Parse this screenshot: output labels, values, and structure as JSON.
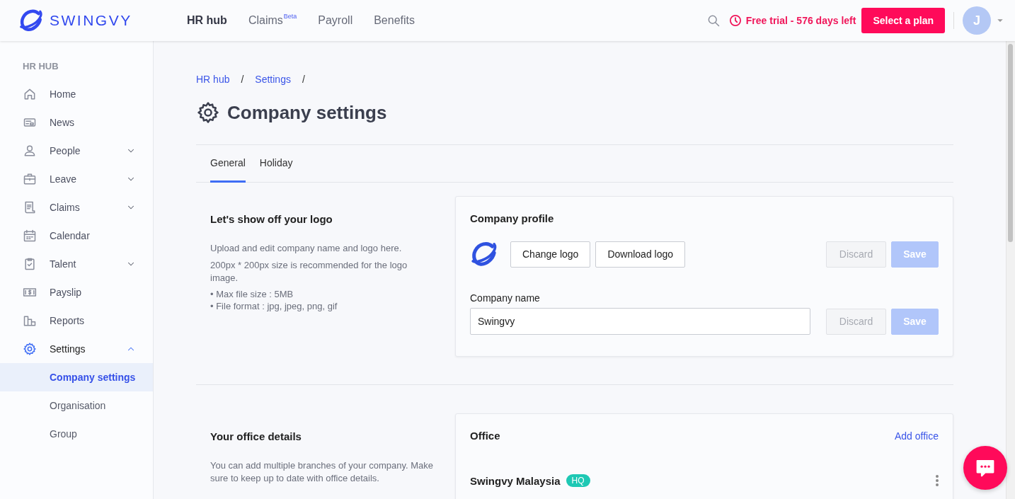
{
  "header": {
    "brand": "SWINGVY",
    "nav": [
      {
        "label": "HR hub",
        "selected": true
      },
      {
        "label": "Claims",
        "selected": false,
        "badge": "Beta"
      },
      {
        "label": "Payroll",
        "selected": false
      },
      {
        "label": "Benefits",
        "selected": false
      }
    ],
    "trial": "Free trial - 576 days left",
    "plan_button": "Select a plan",
    "avatar": "J"
  },
  "sidebar": {
    "heading": "HR HUB",
    "items": [
      {
        "label": "Home",
        "selected": false
      },
      {
        "label": "News",
        "selected": false
      },
      {
        "label": "People",
        "selected": false,
        "expanded": false
      },
      {
        "label": "Leave",
        "selected": false,
        "expanded": false
      },
      {
        "label": "Claims",
        "selected": false,
        "expanded": false
      },
      {
        "label": "Calendar",
        "selected": false
      },
      {
        "label": "Talent",
        "selected": false,
        "expanded": false
      },
      {
        "label": "Payslip",
        "selected": false
      },
      {
        "label": "Reports",
        "selected": false
      },
      {
        "label": "Settings",
        "selected": true,
        "expanded": true,
        "children": [
          {
            "label": "Company settings",
            "selected": true
          },
          {
            "label": "Organisation",
            "selected": false
          },
          {
            "label": "Group",
            "selected": false
          }
        ]
      }
    ]
  },
  "breadcrumb": [
    {
      "label": "HR hub",
      "separator": "/"
    },
    {
      "label": "Settings",
      "separator": "/"
    }
  ],
  "title": "Company settings",
  "tabs": [
    {
      "label": "General",
      "selected": true
    },
    {
      "label": "Holiday",
      "selected": false
    }
  ],
  "logo_section": {
    "heading": "Let's show off your logo",
    "description": [
      "Upload and edit company name and logo here.",
      "200px * 200px size is recommended for the logo image."
    ],
    "bullets": [
      "• Max file size : 5MB",
      "• File format : jpg, jpeg, png, gif"
    ],
    "card": {
      "title": "Company profile",
      "logo_buttons": [
        "Change logo",
        "Download logo"
      ],
      "logo_actions": [
        {
          "label": "Discard",
          "kind": "discard",
          "disabled": true
        },
        {
          "label": "Save",
          "kind": "save",
          "disabled": true
        }
      ],
      "name_label": "Company name",
      "name_value": "Swingvy",
      "name_actions": [
        {
          "label": "Discard",
          "kind": "discard",
          "disabled": true
        },
        {
          "label": "Save",
          "kind": "save",
          "disabled": true
        }
      ]
    }
  },
  "office_section": {
    "heading": "Your office details",
    "description": "You can add multiple branches of your company. Make sure to keep up to date with office details.",
    "card": {
      "title": "Office",
      "add_link": "Add office",
      "offices": [
        {
          "name": "Swingvy Malaysia",
          "badge": "HQ"
        }
      ]
    }
  }
}
